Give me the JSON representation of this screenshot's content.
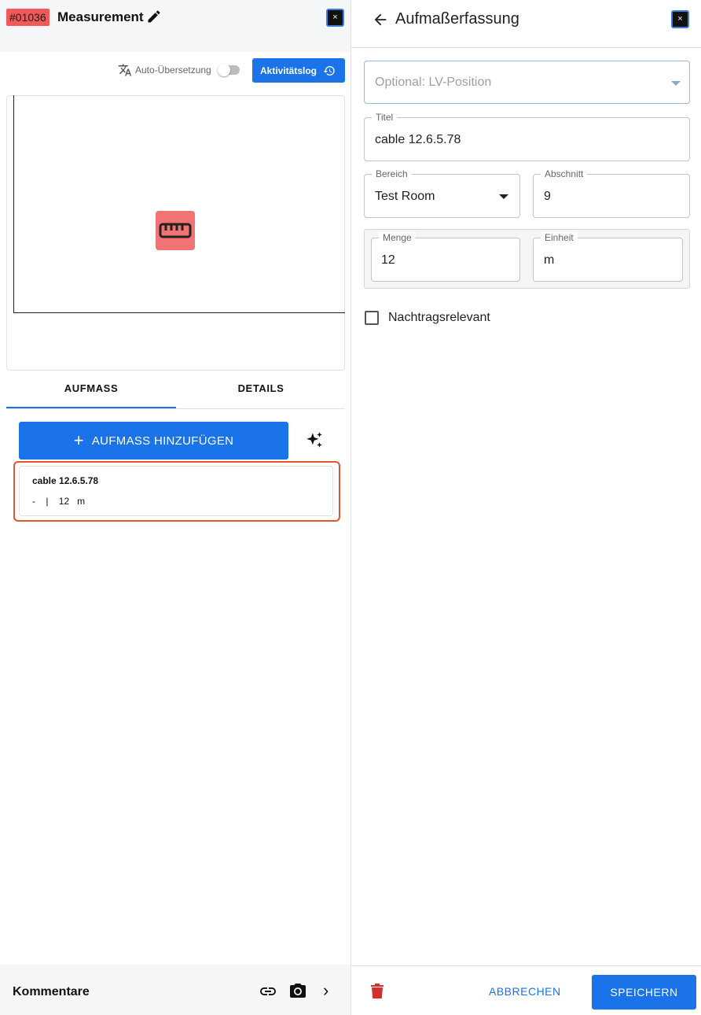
{
  "left_panel": {
    "id_badge": "#01036",
    "title": "Measurement",
    "close_label": "×",
    "auto_translation_label": "Auto-Übersetzung",
    "activity_log_label": "Aktivitätslog",
    "tabs": [
      {
        "label": "AUFMASS",
        "active": true
      },
      {
        "label": "DETAILS",
        "active": false
      }
    ],
    "add_button_label": "AUFMASS HINZUFÜGEN",
    "add_button_icon": "+",
    "measurements": [
      {
        "title": "cable 12.6.5.78",
        "meta": "-    |    12   m"
      }
    ],
    "comments_label": "Kommentare",
    "comments_chevron": "›"
  },
  "right_panel": {
    "title": "Aufmaßerfassung",
    "close_label": "×",
    "lv_position": {
      "placeholder": "Optional: LV-Position"
    },
    "title_field": {
      "label": "Titel",
      "value": "cable 12.6.5.78"
    },
    "bereich": {
      "label": "Bereich",
      "value": "Test Room"
    },
    "abschnitt": {
      "label": "Abschnitt",
      "value": "9"
    },
    "menge": {
      "label": "Menge",
      "value": "12"
    },
    "einheit": {
      "label": "Einheit",
      "value": "m"
    },
    "nachtrag": {
      "label": "Nachtragsrelevant",
      "checked": false
    },
    "cancel_label": "ABBRECHEN",
    "save_label": "SPEICHERN"
  },
  "colors": {
    "primary": "#1a73e8",
    "badge": "#f25a5a",
    "highlight": "#e4572e",
    "delete": "#d32f2f"
  }
}
